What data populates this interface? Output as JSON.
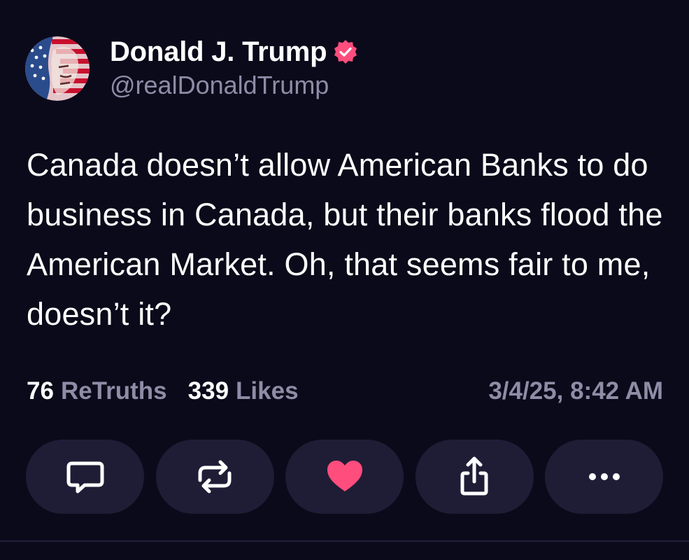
{
  "author": {
    "display_name": "Donald J. Trump",
    "handle": "@realDonaldTrump",
    "verified_color": "#ff4d7d",
    "avatar_icon": "avatar-flag-portrait"
  },
  "post": {
    "text": "Canada doesn’t allow American Banks to do business in Canada, but their banks flood the American Market. Oh, that seems fair to me, doesn’t it?"
  },
  "stats": {
    "retruths_count": "76",
    "retruths_label": "ReTruths",
    "likes_count": "339",
    "likes_label": "Likes",
    "timestamp": "3/4/25, 8:42 AM"
  },
  "actions": [
    {
      "name": "reply",
      "icon": "comment-icon"
    },
    {
      "name": "retruth",
      "icon": "repost-icon"
    },
    {
      "name": "like",
      "icon": "heart-icon",
      "color": "#ff4d7d"
    },
    {
      "name": "share",
      "icon": "share-icon"
    },
    {
      "name": "more",
      "icon": "more-icon"
    }
  ],
  "colors": {
    "background": "#0b0a1a",
    "button_bg": "#1f1d36",
    "muted_text": "#8e8ca6",
    "accent": "#ff4d7d"
  }
}
